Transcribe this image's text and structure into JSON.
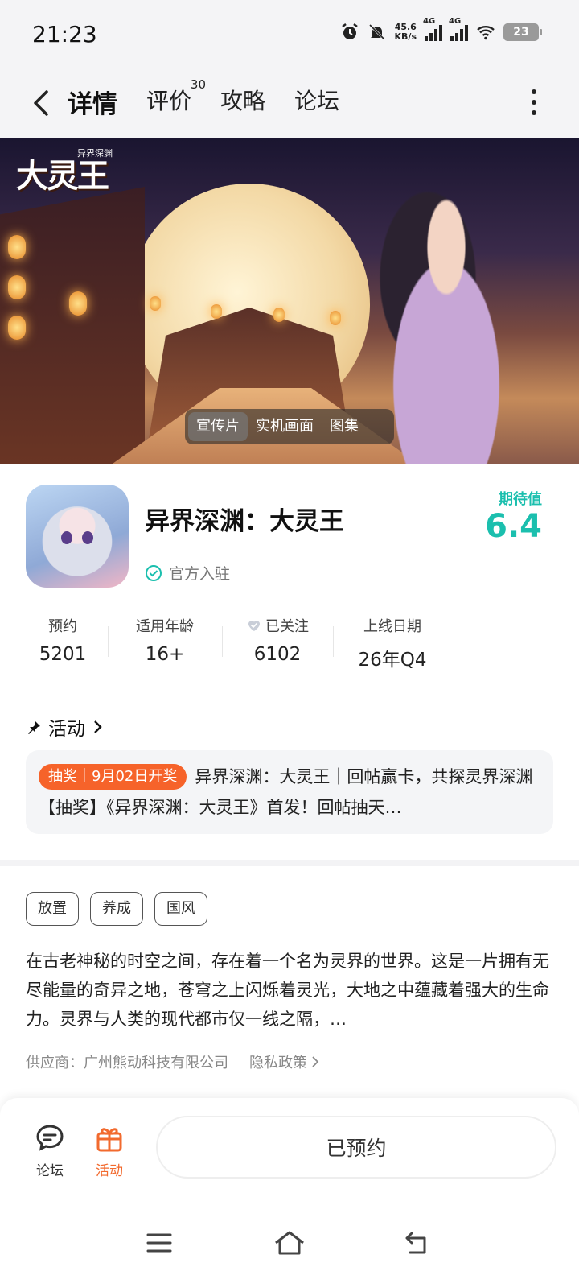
{
  "status_bar": {
    "time": "21:23",
    "net_speed_value": "45.6",
    "net_speed_unit": "KB/s",
    "sim1": "4G",
    "sim2": "4G",
    "battery": "23"
  },
  "nav": {
    "tabs": [
      {
        "label": "详情",
        "active": true
      },
      {
        "label": "评价",
        "badge": "30"
      },
      {
        "label": "攻略"
      },
      {
        "label": "论坛"
      }
    ]
  },
  "banner": {
    "logo_text": "大灵王",
    "logo_subtext": "异界深渊",
    "media_tabs": [
      {
        "label": "宣传片",
        "active": true
      },
      {
        "label": "实机画面"
      },
      {
        "label": "图集"
      }
    ]
  },
  "game": {
    "title": "异界深渊：大灵王",
    "official_label": "官方入驻",
    "expect_label": "期待值",
    "expect_score": "6.4",
    "accent_color": "#1bbfae"
  },
  "stats": [
    {
      "key": "预约",
      "value": "5201"
    },
    {
      "key": "适用年龄",
      "value": "16+"
    },
    {
      "key": "已关注",
      "value": "6102"
    },
    {
      "key": "上线日期",
      "value": "26年Q4"
    }
  ],
  "activity": {
    "header": "活动",
    "badge": "抽奖｜9月02日开奖",
    "text": "异界深渊：大灵王｜回帖赢卡，共探灵界深渊【抽奖】《异界深渊：大灵王》首发！回帖抽天…",
    "badge_color": "#f6632a"
  },
  "tags": [
    "放置",
    "养成",
    "国风"
  ],
  "description": "在古老神秘的时空之间，存在着一个名为灵界的世界。这是一片拥有无尽能量的奇异之地，苍穹之上闪烁着灵光，大地之中蕴藏着强大的生命力。灵界与人类的现代都市仅一线之隔，…",
  "supplier": {
    "label": "供应商：广州熊动科技有限公司",
    "privacy": "隐私政策"
  },
  "bottom_bar": {
    "forum_label": "论坛",
    "activity_label": "活动",
    "reserve_button": "已预约",
    "activity_color": "#f26a2e"
  }
}
